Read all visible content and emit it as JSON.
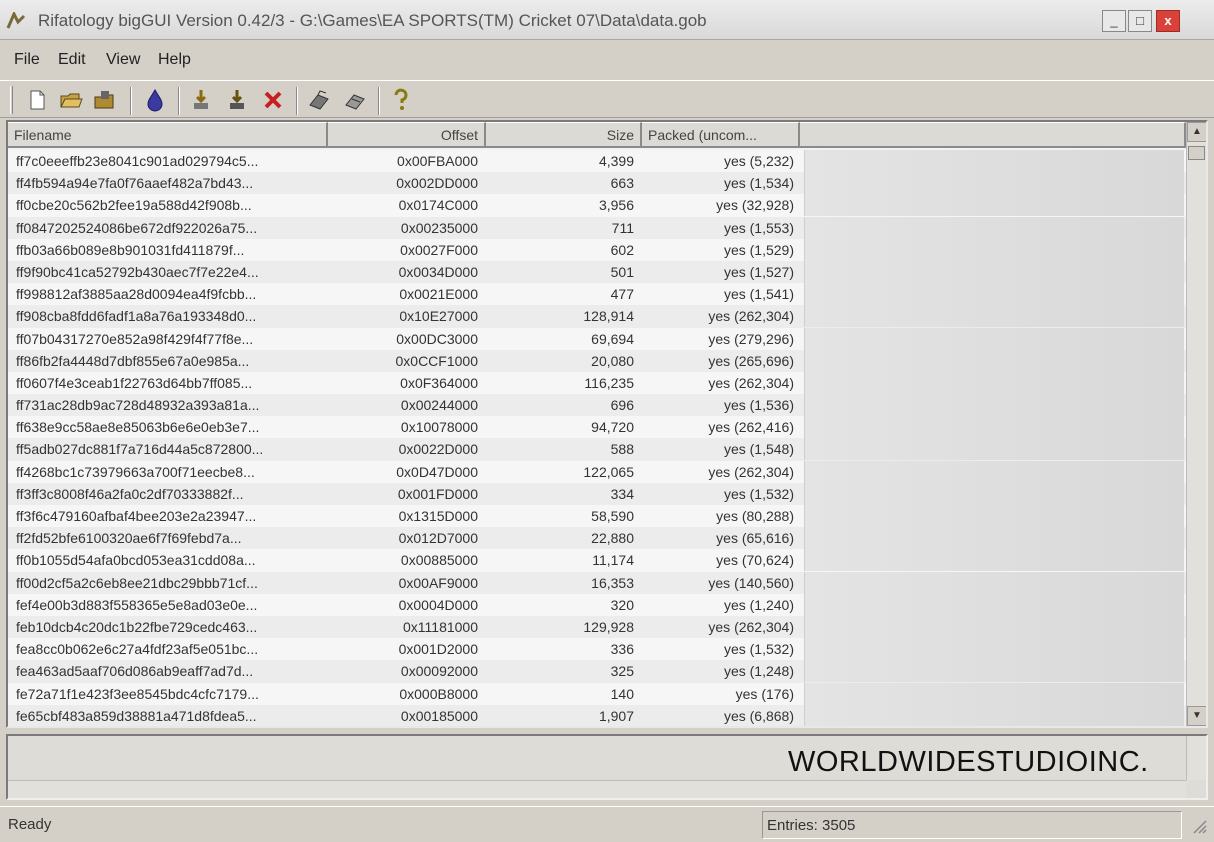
{
  "window": {
    "title": "Rifatology bigGUI Version 0.42/3 - G:\\Games\\EA SPORTS(TM) Cricket 07\\Data\\data.gob",
    "buttons": {
      "minimize": "_",
      "maximize": "□",
      "close": "x"
    }
  },
  "menu": [
    "File",
    "Edit",
    "View",
    "Help"
  ],
  "toolbar": {
    "icons": [
      "new-file-icon",
      "open-folder-icon",
      "open-archive-icon",
      "drop-icon",
      "extract-icon",
      "extract-all-icon",
      "delete-icon",
      "pack-icon",
      "rebuild-icon",
      "help-icon"
    ]
  },
  "columns": {
    "filename": "Filename",
    "offset": "Offset",
    "size": "Size",
    "packed": "Packed (uncom..."
  },
  "rows": [
    {
      "name": "ff7c0eeeffb23e8041c901ad029794c5...",
      "offset": "0x00FBA000",
      "size": "4,399",
      "packed": "yes (5,232)"
    },
    {
      "name": "ff4fb594a94e7fa0f76aaef482a7bd43...",
      "offset": "0x002DD000",
      "size": "663",
      "packed": "yes (1,534)"
    },
    {
      "name": "ff0cbe20c562b2fee19a588d42f908b...",
      "offset": "0x0174C000",
      "size": "3,956",
      "packed": "yes (32,928)"
    },
    {
      "name": "ff0847202524086be672df922026a75...",
      "offset": "0x00235000",
      "size": "711",
      "packed": "yes (1,553)"
    },
    {
      "name": "ffb03a66b089e8b901031fd411879f...",
      "offset": "0x0027F000",
      "size": "602",
      "packed": "yes (1,529)"
    },
    {
      "name": "ff9f90bc41ca52792b430aec7f7e22e4...",
      "offset": "0x0034D000",
      "size": "501",
      "packed": "yes (1,527)"
    },
    {
      "name": "ff998812af3885aa28d0094ea4f9fcbb...",
      "offset": "0x0021E000",
      "size": "477",
      "packed": "yes (1,541)"
    },
    {
      "name": "ff908cba8fdd6fadf1a8a76a193348d0...",
      "offset": "0x10E27000",
      "size": "128,914",
      "packed": "yes (262,304)"
    },
    {
      "name": "ff07b04317270e852a98f429f4f77f8e...",
      "offset": "0x00DC3000",
      "size": "69,694",
      "packed": "yes (279,296)"
    },
    {
      "name": "ff86fb2fa4448d7dbf855e67a0e985a...",
      "offset": "0x0CCF1000",
      "size": "20,080",
      "packed": "yes (265,696)"
    },
    {
      "name": "ff0607f4e3ceab1f22763d64bb7ff085...",
      "offset": "0x0F364000",
      "size": "116,235",
      "packed": "yes (262,304)"
    },
    {
      "name": "ff731ac28db9ac728d48932a393a81a...",
      "offset": "0x00244000",
      "size": "696",
      "packed": "yes (1,536)"
    },
    {
      "name": "ff638e9cc58ae8e85063b6e6e0eb3e7...",
      "offset": "0x10078000",
      "size": "94,720",
      "packed": "yes (262,416)"
    },
    {
      "name": "ff5adb027dc881f7a716d44a5c872800...",
      "offset": "0x0022D000",
      "size": "588",
      "packed": "yes (1,548)"
    },
    {
      "name": "ff4268bc1c73979663a700f71eecbe8...",
      "offset": "0x0D47D000",
      "size": "122,065",
      "packed": "yes (262,304)"
    },
    {
      "name": "ff3ff3c8008f46a2fa0c2df70333882f...",
      "offset": "0x001FD000",
      "size": "334",
      "packed": "yes (1,532)"
    },
    {
      "name": "ff3f6c479160afbaf4bee203e2a23947...",
      "offset": "0x1315D000",
      "size": "58,590",
      "packed": "yes (80,288)"
    },
    {
      "name": "ff2fd52bfe6100320ae6f7f69febd7a...",
      "offset": "0x012D7000",
      "size": "22,880",
      "packed": "yes (65,616)"
    },
    {
      "name": "ff0b1055d54afa0bcd053ea31cdd08a...",
      "offset": "0x00885000",
      "size": "11,174",
      "packed": "yes (70,624)"
    },
    {
      "name": "ff00d2cf5a2c6eb8ee21dbc29bbb71cf...",
      "offset": "0x00AF9000",
      "size": "16,353",
      "packed": "yes (140,560)"
    },
    {
      "name": "fef4e00b3d883f558365e5e8ad03e0e...",
      "offset": "0x0004D000",
      "size": "320",
      "packed": "yes (1,240)"
    },
    {
      "name": "feb10dcb4c20dc1b22fbe729cedc463...",
      "offset": "0x11181000",
      "size": "129,928",
      "packed": "yes (262,304)"
    },
    {
      "name": "fea8cc0b062e6c27a4fdf23af5e051bc...",
      "offset": "0x001D2000",
      "size": "336",
      "packed": "yes (1,532)"
    },
    {
      "name": "fea463ad5aaf706d086ab9eaff7ad7d...",
      "offset": "0x00092000",
      "size": "325",
      "packed": "yes (1,248)"
    },
    {
      "name": "fe72a71f1e423f3ee8545bdc4cfc7179...",
      "offset": "0x000B8000",
      "size": "140",
      "packed": "yes (176)"
    },
    {
      "name": "fe65cbf483a859d38881a471d8fdea5...",
      "offset": "0x00185000",
      "size": "1,907",
      "packed": "yes (6,868)"
    }
  ],
  "log": {
    "watermark": "WORLDWIDESTUDIOINC."
  },
  "status": {
    "left": "Ready",
    "right": "Entries: 3505"
  }
}
